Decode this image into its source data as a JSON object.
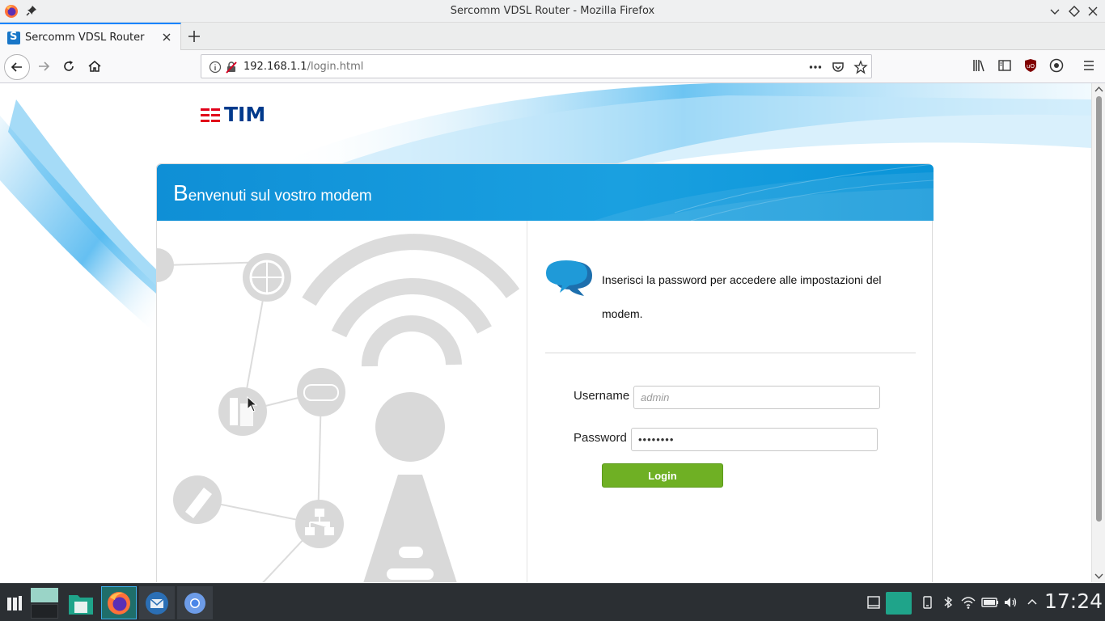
{
  "window": {
    "title": "Sercomm VDSL Router - Mozilla Firefox"
  },
  "tabs": [
    {
      "label": "Sercomm VDSL Router",
      "active": true
    }
  ],
  "urlbar": {
    "host": "192.168.1.1",
    "path": "/login.html"
  },
  "page": {
    "logo_text": "TIM",
    "header_first_letter": "B",
    "header_rest": "envenuti sul vostro modem",
    "intro_text": "Inserisci la password per accedere alle impostazioni del modem.",
    "username_label": "Username",
    "username_placeholder": "admin",
    "password_label": "Password",
    "password_value": "••••••••",
    "login_label": "Login"
  },
  "taskbar": {
    "items": [
      "application-launcher-icon",
      "desktop-pager",
      "file-manager-icon",
      "firefox-icon",
      "thunderbird-icon",
      "chromium-icon"
    ],
    "clock": "17:24"
  },
  "colors": {
    "accent_blue": "#0f8fd6",
    "login_green": "#6fb024",
    "tim_blue": "#003a8c",
    "tim_red": "#e1001a"
  }
}
